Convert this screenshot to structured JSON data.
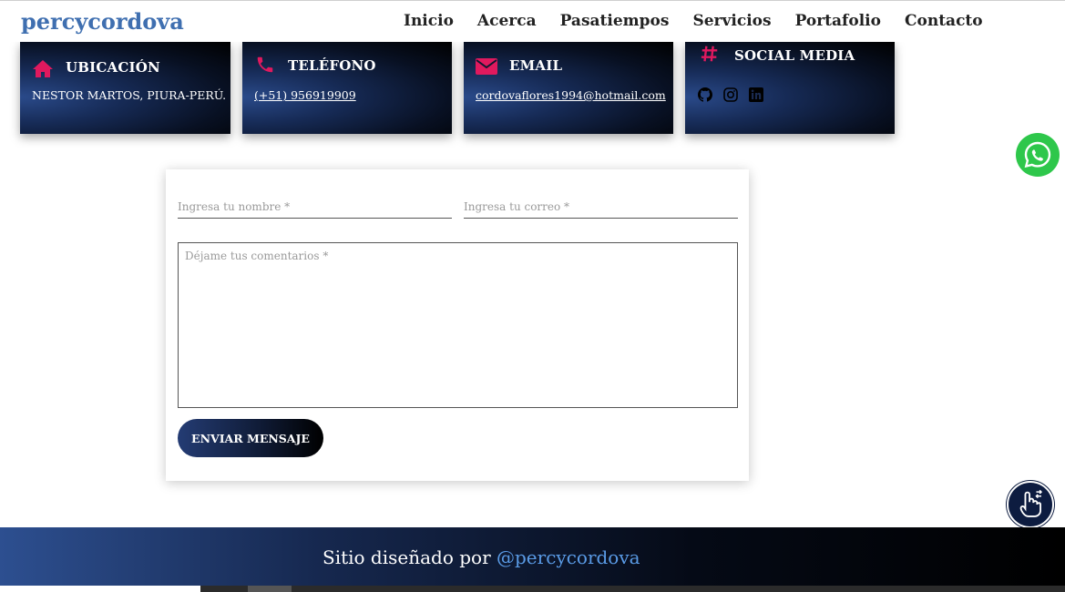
{
  "brand": "percycordova",
  "nav": {
    "items": [
      "Inicio",
      "Acerca",
      "Pasatiempos",
      "Servicios",
      "Portafolio",
      "Contacto"
    ]
  },
  "cards": {
    "location": {
      "title": "UBICACIÓN",
      "text": "NESTOR MARTOS, PIURA-PERÚ.",
      "icon": "home-icon"
    },
    "phone": {
      "title": "TELÉFONO",
      "text": "(+51) 956919909",
      "icon": "phone-icon"
    },
    "email": {
      "title": "EMAIL",
      "text": "cordovaflores1994@hotmail.com",
      "icon": "envelope-icon"
    },
    "social": {
      "title": "SOCIAL MEDIA",
      "icon": "hashtag-icon",
      "links": [
        "github-icon",
        "instagram-icon",
        "linkedin-icon"
      ]
    }
  },
  "form": {
    "name_placeholder": "Ingresa tu nombre *",
    "email_placeholder": "Ingresa tu correo *",
    "comments_placeholder": "Déjame tus comentarios *",
    "submit_label": "ENVIAR MENSAJE"
  },
  "footer": {
    "prefix": "Sitio diseñado por ",
    "handle": "@percycordova"
  },
  "colors": {
    "brand": "#3f6fb0",
    "accent_icon": "#e0195e",
    "card_dark": "#000000",
    "whatsapp": "#2ec74b",
    "footer_link": "#5a9be6"
  }
}
